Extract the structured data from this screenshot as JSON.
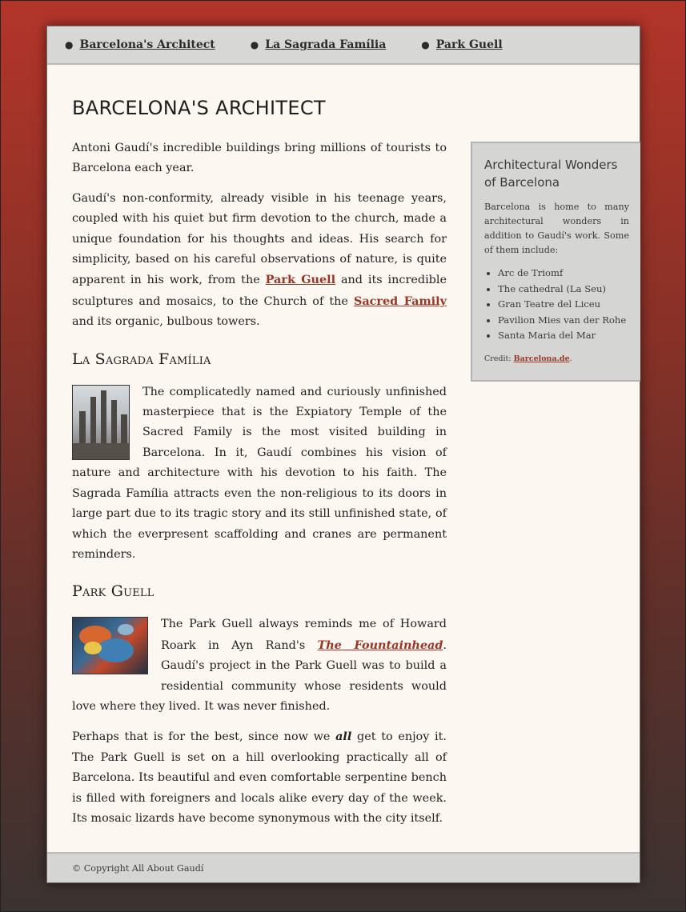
{
  "nav": {
    "items": [
      {
        "label": "Barcelona's Architect"
      },
      {
        "label": "La Sagrada Família"
      },
      {
        "label": "Park Guell"
      }
    ]
  },
  "main": {
    "title": "BARCELONA'S ARCHITECT",
    "intro": "Antoni Gaudí's incredible buildings bring millions of tourists to Barcelona each year.",
    "p2": {
      "a": "Gaudí's non-conformity, already visible in his teenage years, coupled with his quiet but firm devotion to the church, made a unique foundation for his thoughts and ideas. His search for simplicity, based on his careful observations of nature, is quite apparent in his work, from the ",
      "link1": "Park Guell",
      "b": " and its incredible sculptures and mosaics, to the Church of the ",
      "link2": "Sacred Family",
      "c": " and its organic, bulbous towers."
    },
    "sagrada": {
      "heading": "La Sagrada Família",
      "image_icon": "sagrada-familia-photo",
      "text": "The complicatedly named and curiously unfinished masterpiece that is the Expiatory Temple of the Sacred Family is the most visited building in Barcelona. In it, Gaudí combines his vision of nature and architecture with his devotion to his faith. The Sagrada Família attracts even the non-religious to its doors in large part due to its tragic story and its still unfinished state, of which the everpresent scaffolding and cranes are permanent reminders."
    },
    "park": {
      "heading": "Park Guell",
      "image_icon": "park-guell-mosaic-photo",
      "p1": {
        "a": "The Park Guell always reminds me of Howard Roark in Ayn Rand's ",
        "link": "The Fountainhead",
        "b": ". Gaudí's project in the Park Guell was to build a residential community whose residents would love where they lived. It was never finished."
      },
      "p2": {
        "a": "Perhaps that is for the best, since now we ",
        "em": "all",
        "b": " get to enjoy it. The Park Guell is set on a hill overlooking practically all of Barcelona. Its beautiful and even comfortable serpentine bench is filled with foreigners and locals alike every day of the week. Its mosaic lizards have become synonymous with the city itself."
      }
    }
  },
  "sidebar": {
    "title": "Architectural Wonders of Barcelona",
    "intro": "Barcelona is home to many architectural wonders in addition to Gaudí's work. Some of them include:",
    "items": [
      "Arc de Triomf",
      "The cathedral (La Seu)",
      "Gran Teatre del Liceu",
      "Pavilion Mies van der Rohe",
      "Santa Maria del Mar"
    ],
    "credit_label": "Credit: ",
    "credit_link": "Barcelona.de",
    "credit_end": "."
  },
  "footer": {
    "text": "© Copyright All About Gaudí"
  },
  "colors": {
    "link": "#9b3424",
    "page_bg": "#fdf7f1",
    "panel_bg": "#d5d5d4"
  }
}
